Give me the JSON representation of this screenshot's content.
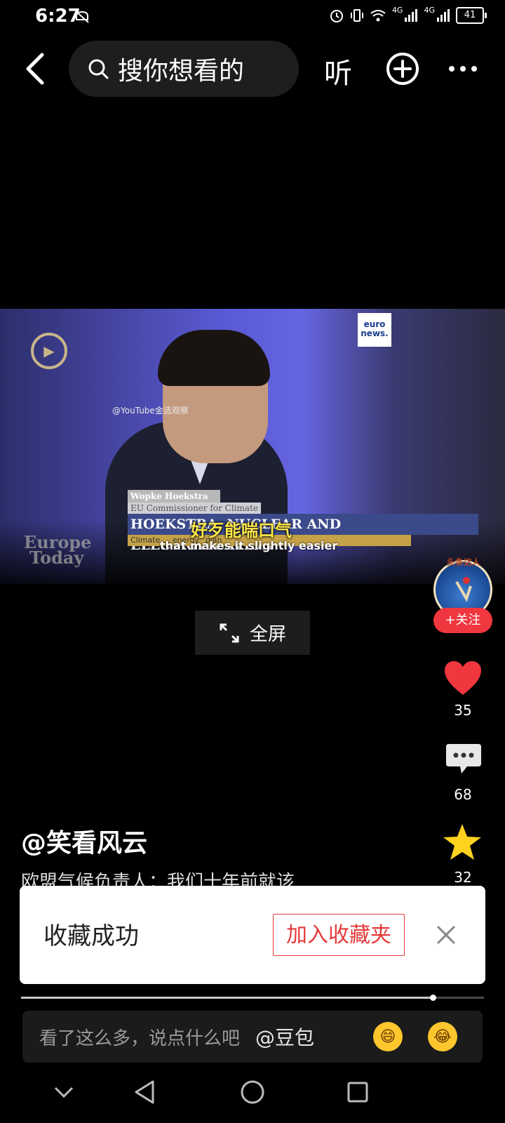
{
  "status_bar": {
    "time": "6:27",
    "network_1": "4G",
    "network_2": "4G",
    "battery": "41"
  },
  "top_nav": {
    "search_placeholder": "搜你想看的",
    "listen_label": "听"
  },
  "video": {
    "watermark": "@YouTube金选观察",
    "channel_logo": "euro news.",
    "lower_third_name": "Wopke Hoekstra",
    "lower_third_role": "EU Commissioner for Climate",
    "headline": "HOEKSTRA: NUCLEAR AND ELECTRIFICATION",
    "ticker": "Climate ... energy\" plan",
    "subtitle_cn": "好歹能喘口气",
    "subtitle_en": "that makes it slightly easier",
    "show_logo_line1": "Europe",
    "show_logo_line2": "Today",
    "fullscreen_label": "全屏"
  },
  "side_actions": {
    "avatar_badge": "头条达人",
    "follow_label": "+关注",
    "likes": "35",
    "comments": "68",
    "favorites": "32"
  },
  "post": {
    "author": "@笑看风云",
    "description": "欧盟气候负责人：我们十年前就该"
  },
  "toast": {
    "title": "收藏成功",
    "add_to_folder": "加入收藏夹"
  },
  "progress": {
    "played_fraction": 0.89
  },
  "comment_bar": {
    "placeholder": "看了这么多，说点什么吧",
    "mention": "@豆包"
  },
  "colors": {
    "accent_red": "#f0363f",
    "toast_red": "#e53a3a",
    "star_yellow": "#ffd21f"
  }
}
